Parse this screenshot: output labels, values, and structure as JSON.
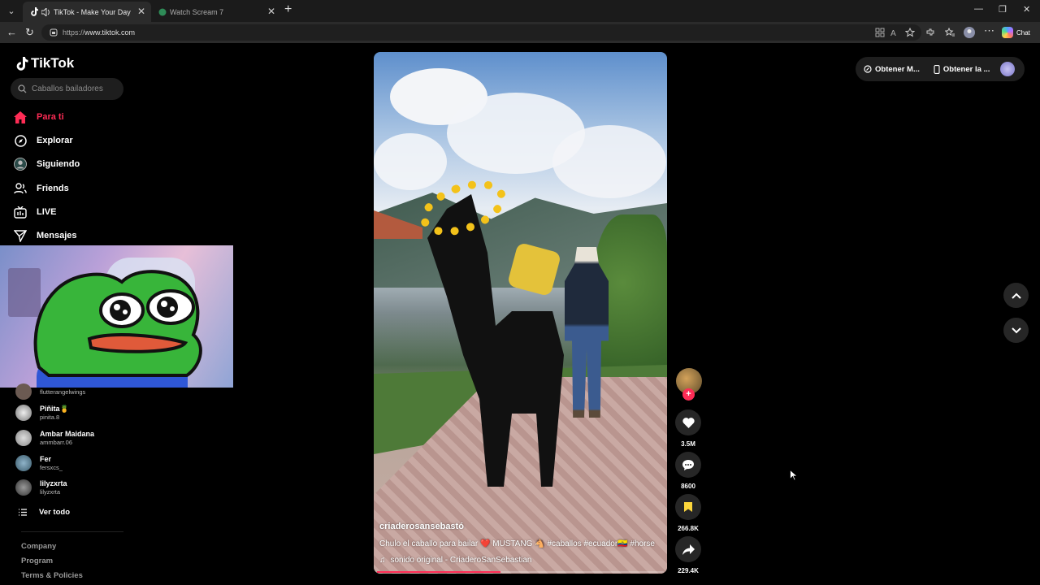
{
  "browser": {
    "tabs": [
      {
        "title": "TikTok - Make Your Day",
        "active": true
      },
      {
        "title": "Watch Scream 7",
        "active": false
      }
    ],
    "url_protocol": "https://",
    "url_host": "www.tiktok.com",
    "chat_label": "Chat"
  },
  "app": {
    "logo_text": "TikTok",
    "search": {
      "placeholder": "Caballos bailadores"
    },
    "nav": [
      {
        "label": "Para ti",
        "icon": "home-icon",
        "active": true
      },
      {
        "label": "Explorar",
        "icon": "compass-icon"
      },
      {
        "label": "Siguiendo",
        "icon": "following-icon"
      },
      {
        "label": "Friends",
        "icon": "friends-icon"
      },
      {
        "label": "LIVE",
        "icon": "live-icon"
      },
      {
        "label": "Mensajes",
        "icon": "send-icon"
      }
    ],
    "following_accounts": [
      {
        "name": "",
        "handle": "flutterangelwings"
      },
      {
        "name": "Piñita🍍",
        "handle": "pinita.8"
      },
      {
        "name": "Ambar Maidana",
        "handle": "ammbarr.06"
      },
      {
        "name": "Fer",
        "handle": "fersxcs_"
      },
      {
        "name": "lilyzxrta",
        "handle": "lilyzxrta"
      }
    ],
    "see_all": "Ver todo",
    "footer_links": [
      "Company",
      "Program",
      "Terms & Policies"
    ],
    "top_right": {
      "item1": "Obtener M...",
      "item2": "Obtener la ..."
    }
  },
  "video": {
    "author": "criaderosansebastó",
    "caption": "Chulo el caballo para bailar ❤️ MUSTANG 🐴 #caballos #ecuador🇪🇨 #horse",
    "sound": "sonido original - CriaderoSanSebastian",
    "progress": 0.43,
    "likes": "3.5M",
    "comments": "8600",
    "saves": "266.8K",
    "shares": "229.4K"
  },
  "colors": {
    "accent": "#fe2c55",
    "save_active": "#fcd63b"
  }
}
